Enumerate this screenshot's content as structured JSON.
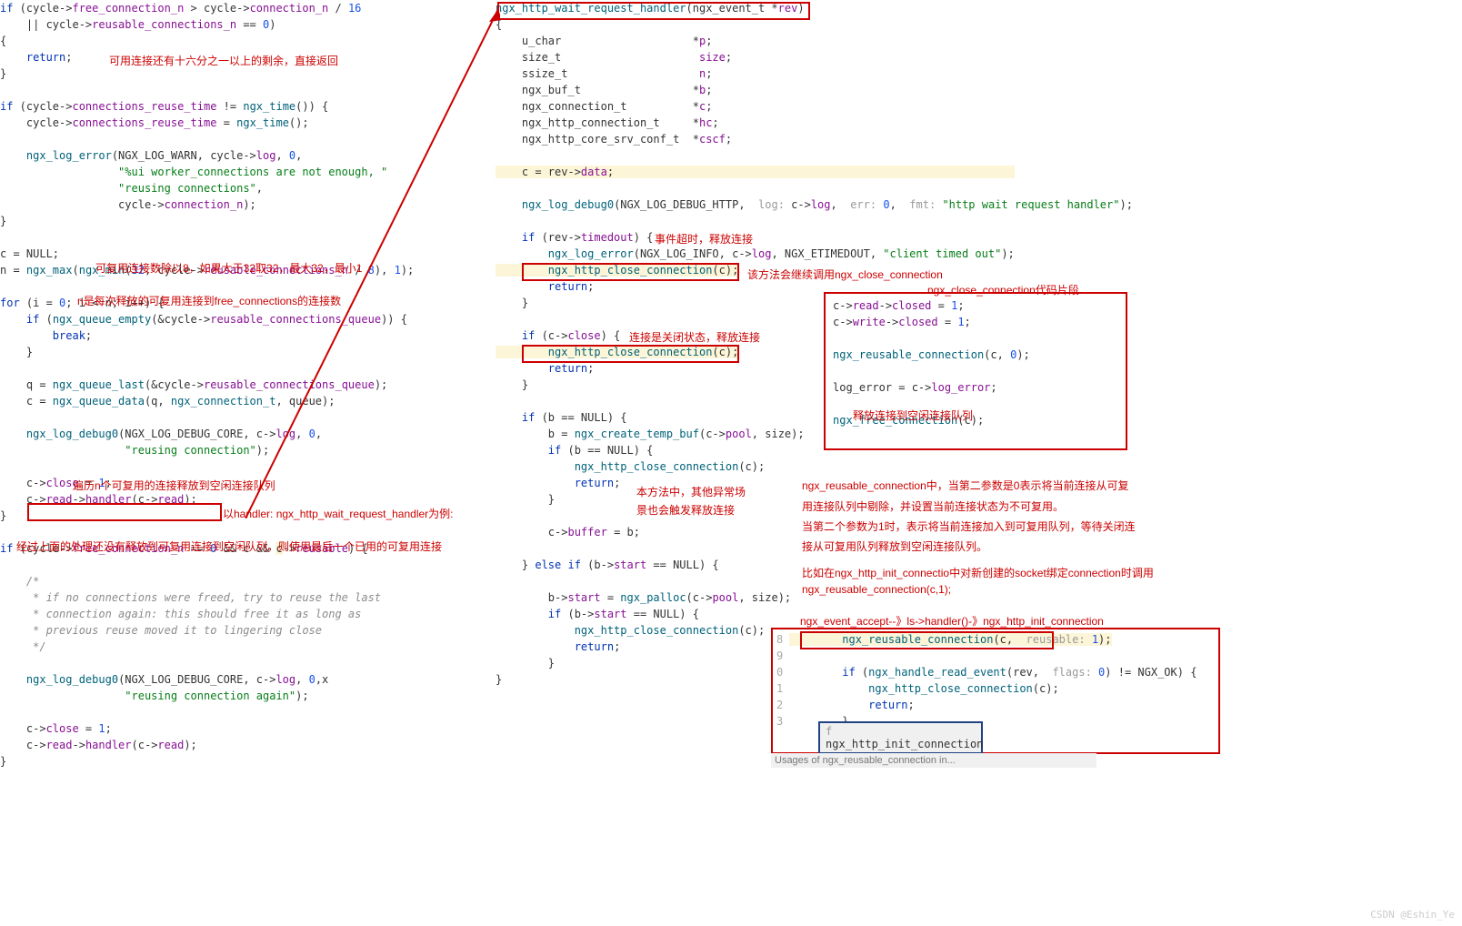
{
  "left_code": {
    "l1": "    if (cycle->free_connection_n > cycle->connection_n / 16",
    "l2": "        || cycle->reusable_connections_n == 0)",
    "l3": "    {",
    "l4": "        return;",
    "l5": "    }",
    "l7": "    if (cycle->connections_reuse_time != ngx_time()) {",
    "l8": "        cycle->connections_reuse_time = ngx_time();",
    "l10": "        ngx_log_error(NGX_LOG_WARN, cycle->log, 0,",
    "l11": "                      \"%ui worker_connections are not enough, \"",
    "l12": "                      \"reusing connections\",",
    "l13": "                      cycle->connection_n);",
    "l14": "    }",
    "l16": "    c = NULL;",
    "l17": "    n = ngx_max(ngx_min(32, cycle->reusable_connections_n / 8), 1);",
    "l19": "    for (i = 0; i < n; i++) {",
    "l20": "        if (ngx_queue_empty(&cycle->reusable_connections_queue)) {",
    "l21": "            break;",
    "l22": "        }",
    "l24": "        q = ngx_queue_last(&cycle->reusable_connections_queue);",
    "l25": "        c = ngx_queue_data(q, ngx_connection_t, queue);",
    "l27": "        ngx_log_debug0(NGX_LOG_DEBUG_CORE, c->log, 0,",
    "l28": "                       \"reusing connection\");",
    "l30": "        c->close = 1;",
    "l31": "        c->read->handler(c->read);",
    "l32": "    }",
    "l34": "    if (cycle->free_connection_n == 0 && c && c->reusable) {",
    "c1": "        /*",
    "c2": "         * if no connections were freed, try to reuse the last",
    "c3": "         * connection again: this should free it as long as",
    "c4": "         * previous reuse moved it to lingering close",
    "c5": "         */",
    "l40": "        ngx_log_debug0(NGX_LOG_DEBUG_CORE, c->log, 0,x",
    "l41": "                       \"reusing connection again\");",
    "l43": "        c->close = 1;",
    "l44": "        c->read->handler(c->read);",
    "l45": "    }",
    "l46": "}"
  },
  "right_code": {
    "r0": "ngx_http_wait_request_handler(ngx_event_t *rev)",
    "r1": "{",
    "r2": "    u_char                    *p;",
    "r3": "    size_t                     size;",
    "r4": "    ssize_t                    n;",
    "r5": "    ngx_buf_t                 *b;",
    "r6": "    ngx_connection_t          *c;",
    "r7": "    ngx_http_connection_t     *hc;",
    "r8": "    ngx_http_core_srv_conf_t  *cscf;",
    "r10": "    c = rev->data;",
    "r12": "    ngx_log_debug0(NGX_LOG_DEBUG_HTTP,  log: c->log,  err: 0,  fmt: \"http wait request handler\");",
    "r14": "    if (rev->timedout) {",
    "r15": "        ngx_log_error(NGX_LOG_INFO, c->log, NGX_ETIMEDOUT, \"client timed out\");",
    "r16": "        ngx_http_close_connection(c);",
    "r17": "        return;",
    "r18": "    }",
    "r20": "    if (c->close) {",
    "r21": "        ngx_http_close_connection(c);",
    "r22": "        return;",
    "r23": "    }",
    "r25": "    if (b == NULL) {",
    "r26": "        b = ngx_create_temp_buf(c->pool, size);",
    "r27": "        if (b == NULL) {",
    "r28": "            ngx_http_close_connection(c);",
    "r29": "            return;",
    "r30": "        }",
    "r32": "        c->buffer = b;",
    "r34": "    } else if (b->start == NULL) {",
    "r36": "        b->start = ngx_palloc(c->pool, size);",
    "r37": "        if (b->start == NULL) {",
    "r38": "            ngx_http_close_connection(c);",
    "r39": "            return;",
    "r40": "        }",
    "r41": "}"
  },
  "side": {
    "s1": "c->read->closed = 1;",
    "s2": "c->write->closed = 1;",
    "s3": "ngx_reusable_connection(c, 0);",
    "s4": "log_error = c->log_error;",
    "s5": "ngx_free_connection(c);"
  },
  "bottom": {
    "b1": "        ngx_reusable_connection(c,  reusable: 1);",
    "b2": "        if (ngx_handle_read_event(rev,  flags: 0) != NGX_OK) {",
    "b3": "            ngx_http_close_connection(c);",
    "b4": "            return;",
    "b5": "        }",
    "fn": "ngx_http_init_connection"
  },
  "anno": {
    "a1": "可用连接还有十六分之一以上的剩余，直接返回",
    "a2": "可复用连接数除以8，如果大于32取32，最大32，最小1",
    "a3": "n是每次释放的可复用连接到free_connections的连接数",
    "a4": "遍历n个可复用的连接释放到空闲连接队列",
    "a5": "以handler: ngx_http_wait_request_handler为例:",
    "a6": "经过上面的处理还没有释放到可复用连接到空闲队列，则使用最后一个已用的可复用连接",
    "a7": "事件超时，释放连接",
    "a8": "该方法会继续调用ngx_close_connection",
    "a9": "连接是关闭状态，释放连接",
    "a10": "ngx_close_connection代码片段",
    "a11": "释放连接到空闲连接队列",
    "a12": "本方法中，其他异常场",
    "a13": "景也会触发释放连接",
    "a14": "ngx_reusable_connection中，当第二参数是0表示将当前连接从可复",
    "a15": "用连接队列中剔除，并设置当前连接状态为不可复用。",
    "a16": "当第二个参数为1时，表示将当前连接加入到可复用队列，等待关闭连",
    "a17": "接从可复用队列释放到空闲连接队列。",
    "a18": "比如在ngx_http_init_connectio中对新创建的socket绑定connection时调用",
    "a19": "ngx_reusable_connection(c,1);",
    "a20": "ngx_event_accept--》ls->handler()-》ngx_http_init_connection"
  },
  "usages": "Usages of ngx_reusable_connection in...",
  "watermark": "CSDN @Eshin_Ye"
}
